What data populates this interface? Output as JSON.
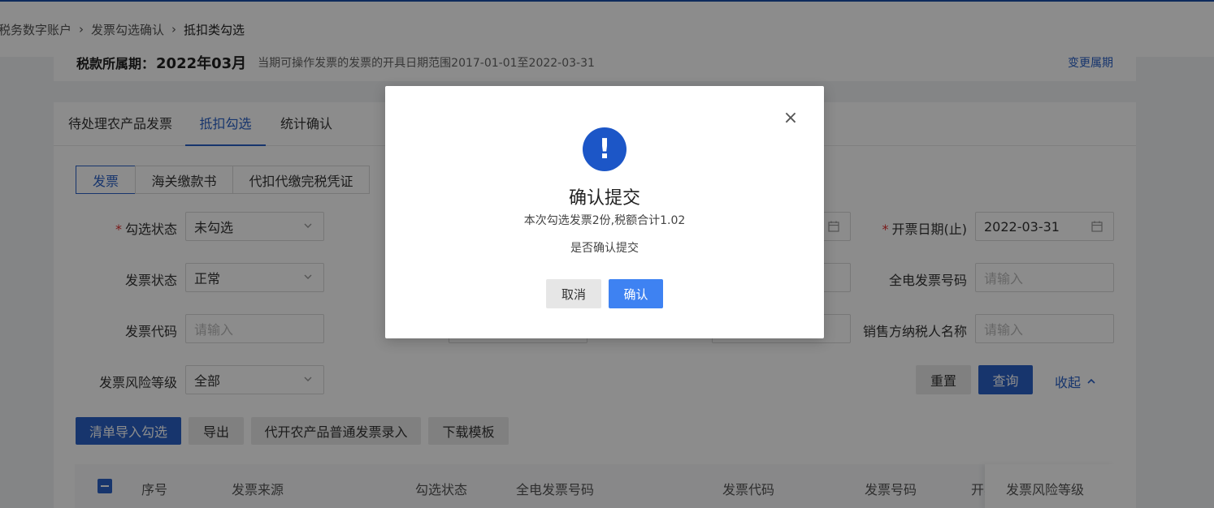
{
  "breadcrumb": [
    "税务数字账户",
    "发票勾选确认",
    "抵扣类勾选"
  ],
  "tax_period": {
    "label": "税款所属期：",
    "value": "2022年03月",
    "hint": "当期可操作发票的发票的开具日期范围2017-01-01至2022-03-31",
    "change_link": "变更属期"
  },
  "tabs": [
    "待处理农产品发票",
    "抵扣勾选",
    "统计确认"
  ],
  "doc_types": [
    "发票",
    "海关缴款书",
    "代扣代缴完税凭证"
  ],
  "form": {
    "select_status_label": "勾选状态",
    "select_status_value": "未勾选",
    "invoice_status_label": "发票状态",
    "invoice_status_value": "正常",
    "invoice_code_label": "发票代码",
    "invoice_code_placeholder": "请输入",
    "risk_level_label": "发票风险等级",
    "risk_level_value": "全部",
    "issue_date_end_label": "开票日期(止)",
    "issue_date_end_value": "2022-03-31",
    "full_invoice_no_label": "全电发票号码",
    "full_invoice_no_placeholder": "请输入",
    "seller_name_label": "销售方纳税人名称",
    "seller_name_placeholder": "请输入"
  },
  "actions": {
    "reset": "重置",
    "query": "查询",
    "collapse": "收起"
  },
  "toolbar": [
    "清单导入勾选",
    "导出",
    "代开农产品普通发票录入",
    "下载模板"
  ],
  "table_headers": [
    "序号",
    "发票来源",
    "勾选状态",
    "全电发票号码",
    "发票代码",
    "发票号码",
    "开票",
    "发票风险等级"
  ],
  "modal": {
    "title": "确认提交",
    "description": "本次勾选发票2份,税额合计1.02",
    "question": "是否确认提交",
    "cancel": "取消",
    "confirm": "确认"
  }
}
